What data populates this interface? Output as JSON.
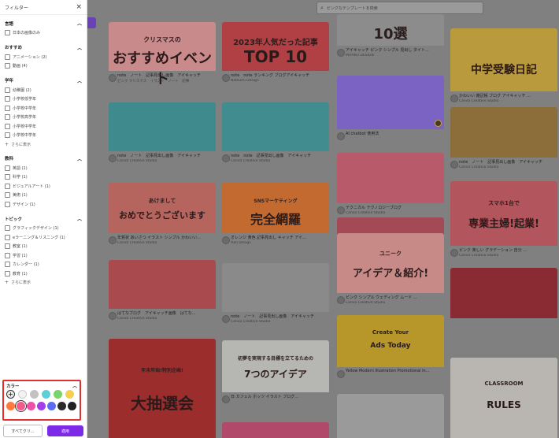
{
  "sidebar": {
    "title": "フィルター",
    "sections": [
      {
        "title": "言語",
        "options": [
          "日本の画像のみ"
        ],
        "more": ""
      },
      {
        "title": "おすすめ",
        "options": [
          "アニメーション (2)",
          "動画 (4)"
        ],
        "more": ""
      },
      {
        "title": "学年",
        "options": [
          "幼稚園 (2)",
          "小学校低学年",
          "小学校中学年",
          "小学校高学年",
          "小学校中学年",
          "小学校中学年"
        ],
        "more": "さらに表示"
      },
      {
        "title": "教科",
        "options": [
          "英語 (1)",
          "科学 (1)",
          "ビジュアルアート (1)",
          "美術 (1)",
          "デザイン (1)"
        ],
        "more": ""
      },
      {
        "title": "トピック",
        "options": [
          "グラフィックデザイン (1)",
          "eラーニング＆リスニング (1)",
          "教室 (1)",
          "学習 (1)",
          "カレンダー (1)",
          "教育 (1)"
        ],
        "more": "さらに表示"
      }
    ],
    "color_title": "カラー",
    "colors_row1": [
      "#e8e8e8",
      "#f2f2f2",
      "#c2c2c2",
      "#5bd0d8",
      "#7ad36b",
      "#f6d04d"
    ],
    "colors_row2": [
      "#ff7a3c",
      "#f05a8c",
      "#ee4fa8",
      "#a23ee8",
      "#5b6cf0",
      "#2a2a2a",
      "#222222"
    ],
    "clear_label": "すべてクリ...",
    "apply_label": "適用"
  },
  "search": {
    "placeholder": "ピンクなテンプレートを検索"
  },
  "cards": [
    {
      "id": "c1",
      "title1": "クリスマスの",
      "title2": "おすすめイベント",
      "meta1": "note　ノート　記事見出し画像　アイキャッチ",
      "meta2": "ピンク クリスマス　イラスト　ノート　記事",
      "bg": "#c98a8c",
      "pro": false
    },
    {
      "id": "c2",
      "title1": "2023年人気だった記事",
      "title2": "TOP 10",
      "meta1": "note　note ランキング ブログアイキャッチ",
      "meta2": "Natsumi Design",
      "bg": "#b04044",
      "pro": false
    },
    {
      "id": "c3",
      "title1": "10選",
      "title2": "",
      "meta1": "アイキャッチ ピンク シンプル 見出し タイト...",
      "meta2": "MIYAKO DESIGN",
      "bg": "#8c8c8c",
      "pro": false
    },
    {
      "id": "c4",
      "title1": "",
      "title2": "中学受験日記",
      "meta1": "かわいい 雑記帳 ブログ アイキャッチ ...",
      "meta2": "Canva Creative Studio",
      "bg": "#b99a3c",
      "pro": false
    },
    {
      "id": "c5",
      "title1": "",
      "title2": "",
      "meta1": "AI chatbot 使用法",
      "meta2": "",
      "bg": "#7a63c2",
      "pro": true
    },
    {
      "id": "c6",
      "title1": "",
      "title2": "",
      "meta1": "テクニカル テクノロジーブログ",
      "meta2": "Canva Creative Studio",
      "bg": "#b85a6a",
      "pro": false
    },
    {
      "id": "c7",
      "title1": "",
      "title2": "",
      "meta1": "note　ノート　記事見出し画像　アイキャッチ",
      "meta2": "Canva Creative Studio",
      "bg": "#3e8a8c",
      "pro": false
    },
    {
      "id": "c8",
      "title1": "",
      "title2": "",
      "meta1": "note　note　記事見出し画像　アイキャッチ",
      "meta2": "Canva Creative Studio",
      "bg": "#408c8e",
      "pro": false
    },
    {
      "id": "c9",
      "title1": "",
      "title2": "",
      "meta1": "note　ノート　記事見出し画像　アイキャッチ",
      "meta2": "Canva Creative Studio",
      "bg": "#8c6e3a",
      "pro": false
    },
    {
      "id": "c10",
      "title1": "",
      "title2": "",
      "meta1": "はてなブログ アイキャッチ画像 はてな...",
      "meta2": "Canva Creative Studio",
      "bg": "#a34a56",
      "pro": true
    },
    {
      "id": "c11",
      "title1": "あけまして",
      "title2": "おめでとうございます",
      "meta1": "年賀状 あいさつ イラスト シンプル かわいい...",
      "meta2": "Canva Creative Studio",
      "bg": "#b6645e",
      "pro": false
    },
    {
      "id": "c12",
      "title1": "SNSマーケティング",
      "title2": "完全網羅",
      "meta1": "オレンジ 黄色 記事見出し キャッチ アイ...",
      "meta2": "Yuki Design",
      "bg": "#c26a30",
      "pro": false
    },
    {
      "id": "c13",
      "title1": "ユニーク",
      "title2": "アイデア＆紹介!",
      "meta1": "ピンク シンプル ウェディング ムード ...",
      "meta2": "Canva Creative Studio",
      "bg": "#c78a86",
      "pro": false
    },
    {
      "id": "c14",
      "title1": "スマホ1台で",
      "title2": "専業主婦!起業!",
      "meta1": "ピンク 楽しい グラデーション 自分 ...",
      "meta2": "Canva Creative Studio",
      "bg": "#b2555c",
      "pro": false
    },
    {
      "id": "c15",
      "title1": "",
      "title2": "",
      "meta1": "はてなブログ　アイキャッチ画像　はてな...",
      "meta2": "Canva Creative Studio",
      "bg": "#a84a4e",
      "pro": false
    },
    {
      "id": "c16",
      "title1": "",
      "title2": "",
      "meta1": "note　ノート　記事見出し画像　アイキャッチ",
      "meta2": "Canva Creative Studio",
      "bg": "#8a8a8a",
      "pro": false
    },
    {
      "id": "c17",
      "title1": "Create Your",
      "title2": "Ads Today",
      "meta1": "Yellow Modern Illustration Promotional In...",
      "meta2": "",
      "bg": "#b7962a",
      "pro": false
    },
    {
      "id": "c18",
      "title1": "",
      "title2": "",
      "meta1": "",
      "meta2": "",
      "bg": "#8a2b33",
      "pro": false
    },
    {
      "id": "c19",
      "title1": "年末年始!特別企画!",
      "title2": "大抽選会",
      "meta1": "",
      "meta2": "",
      "bg": "#9c2d2d",
      "pro": false
    },
    {
      "id": "c20",
      "title1": "初夢を実現する目標を立てるための",
      "title2": "7つのアイデア",
      "meta1": "日 カフェル ホッツ イラスト ブログ...",
      "meta2": "",
      "bg": "#b6b6b2",
      "pro": false
    },
    {
      "id": "c21",
      "title1": "CLASSROOM",
      "title2": "RULES",
      "meta1": "",
      "meta2": "",
      "bg": "#b9b6b2",
      "pro": false
    },
    {
      "id": "c22",
      "title1": "",
      "title2": "",
      "meta1": "",
      "meta2": "",
      "bg": "#9a9a9a",
      "pro": false
    },
    {
      "id": "c23",
      "title1": "",
      "title2": "",
      "meta1": "",
      "meta2": "",
      "bg": "#b14a6a",
      "pro": false
    }
  ]
}
